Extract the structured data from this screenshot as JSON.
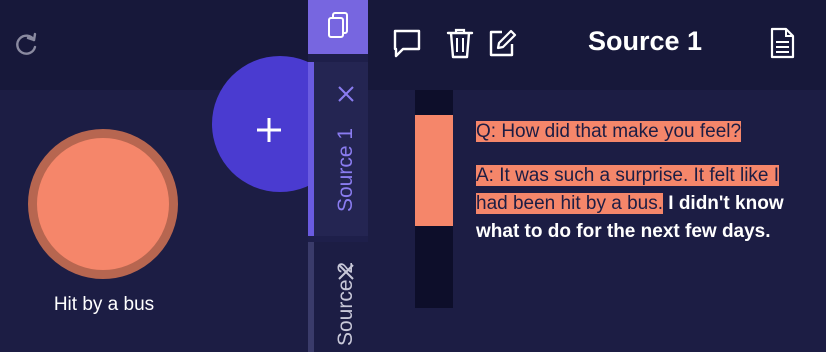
{
  "codes": [
    {
      "label": "Hit by a bus",
      "color": "#f5866a"
    }
  ],
  "tabs": [
    {
      "label": "Source 1",
      "active": true
    },
    {
      "label": "Source 2",
      "active": false
    }
  ],
  "toolbar": {
    "icons": [
      "refresh-icon",
      "comment-icon",
      "trash-icon",
      "edit-icon",
      "document-icon",
      "copy-icon",
      "plus-icon",
      "close-icon"
    ]
  },
  "document": {
    "title": "Source 1",
    "paragraphs": [
      {
        "highlighted": "Q: How did that make you feel?",
        "rest": ""
      },
      {
        "highlighted": "A: It was such a surprise. It felt like I had been hit by a bus.",
        "rest": " I didn't know what to do for the next few days."
      }
    ]
  },
  "colors": {
    "background": "#1c1d44",
    "topbar": "#17183a",
    "accent": "#4a3bd0",
    "tab_accent": "#7766e0",
    "highlight": "#f5866a"
  }
}
